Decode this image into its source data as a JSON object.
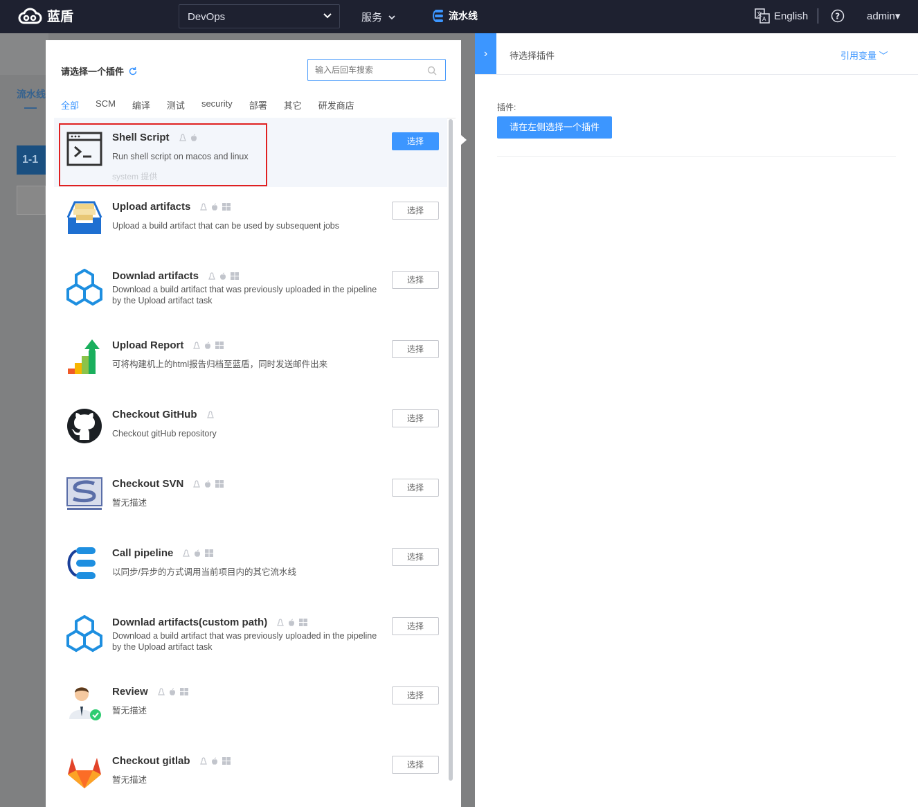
{
  "topbar": {
    "brand": "蓝盾",
    "project": "DevOps",
    "services": "服务",
    "pipeline": "流水线",
    "language": "English",
    "user": "admin"
  },
  "background": {
    "pipeline_tab": "流水线",
    "stage": "1-1"
  },
  "modal": {
    "title": "请选择一个插件",
    "search_placeholder": "输入后回车搜索",
    "tabs": [
      "全部",
      "SCM",
      "编译",
      "测试",
      "security",
      "部署",
      "其它",
      "研发商店"
    ],
    "active_tab": "全部",
    "plugins": [
      {
        "name": "Shell Script",
        "desc": "Run shell script on macos and linux",
        "provider": "system 提供",
        "icon": "terminal-icon",
        "os": [
          "linux",
          "mac"
        ],
        "button": "选择",
        "selected": true
      },
      {
        "name": "Upload artifacts",
        "desc": "Upload a build artifact that can be used by subsequent jobs",
        "icon": "upload-box-icon",
        "os": [
          "linux",
          "mac",
          "windows"
        ],
        "button": "选择"
      },
      {
        "name": "Downlad artifacts",
        "desc": "Download a build artifact that was previously uploaded in the pipeline by the Upload artifact task",
        "icon": "cubes-icon",
        "os": [
          "linux",
          "mac",
          "windows"
        ],
        "button": "选择"
      },
      {
        "name": "Upload Report",
        "desc": "可将构建机上的html报告归档至蓝盾，同时发送邮件出来",
        "icon": "bar-chart-arrow-icon",
        "os": [
          "linux",
          "mac",
          "windows"
        ],
        "button": "选择"
      },
      {
        "name": "Checkout GitHub",
        "desc": "Checkout gitHub repository",
        "icon": "github-icon",
        "os": [
          "linux"
        ],
        "button": "选择"
      },
      {
        "name": "Checkout SVN",
        "desc": "暂无描述",
        "icon": "subversion-icon",
        "os": [
          "linux",
          "mac",
          "windows"
        ],
        "button": "选择"
      },
      {
        "name": "Call pipeline",
        "desc": "以同步/异步的方式调用当前项目内的其它流水线",
        "icon": "call-pipeline-icon",
        "os": [
          "linux",
          "mac",
          "windows"
        ],
        "button": "选择"
      },
      {
        "name": "Downlad artifacts(custom path)",
        "desc": "Download a build artifact that was previously uploaded in the pipeline by the Upload artifact task",
        "icon": "cubes-icon",
        "os": [
          "linux",
          "mac",
          "windows"
        ],
        "button": "选择"
      },
      {
        "name": "Review",
        "desc": "暂无描述",
        "icon": "reviewer-icon",
        "os": [
          "linux",
          "mac",
          "windows"
        ],
        "button": "选择"
      },
      {
        "name": "Checkout gitlab",
        "desc": "暂无描述",
        "icon": "gitlab-icon",
        "os": [
          "linux",
          "mac",
          "windows"
        ],
        "button": "选择"
      }
    ]
  },
  "right_panel": {
    "title": "待选择插件",
    "variables_link": "引用变量",
    "plugin_label": "插件:",
    "plugin_button": "请在左侧选择一个插件"
  },
  "colors": {
    "accent": "#3c96ff",
    "topbar": "#1e2130",
    "highlight": "#e02020"
  }
}
